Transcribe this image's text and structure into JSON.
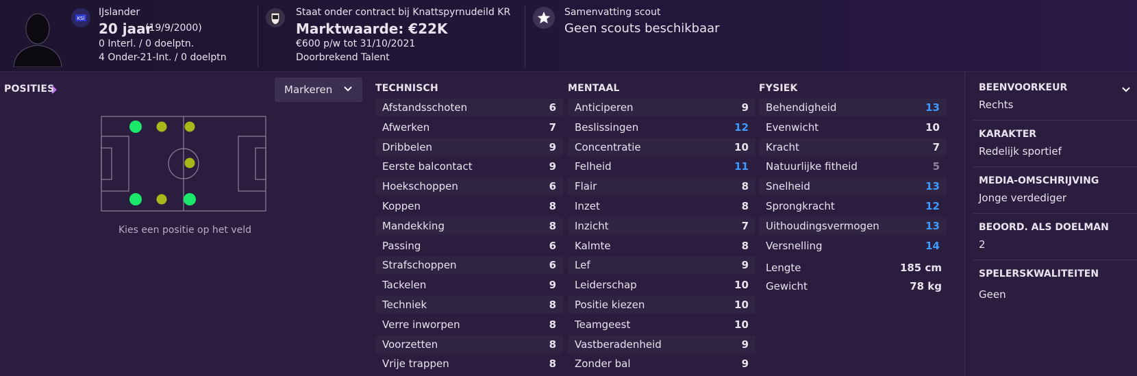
{
  "header": {
    "nationality": "IJslander",
    "age": "20 jaar",
    "birthdate": "(19/9/2000)",
    "caps": "0 Interl. / 0 doelptn.",
    "u21_caps": "4 Onder-21-Int. / 0 doelptn",
    "contract": "Staat onder contract bij Knattspyrnudeild KR",
    "market_value": "Marktwaarde: €22K",
    "wage": "€600 p/w tot 31/10/2021",
    "status": "Doorbrekend Talent",
    "scout_title": "Samenvatting scout",
    "scout_value": "Geen scouts beschikbaar"
  },
  "positions": {
    "label": "POSITIES",
    "mark_button": "Markeren",
    "hint": "Kies een positie op het veld"
  },
  "technical": {
    "title": "TECHNISCH",
    "items": [
      {
        "name": "Afstandsschoten",
        "value": "6"
      },
      {
        "name": "Afwerken",
        "value": "7"
      },
      {
        "name": "Dribbelen",
        "value": "9"
      },
      {
        "name": "Eerste balcontact",
        "value": "9"
      },
      {
        "name": "Hoekschoppen",
        "value": "6"
      },
      {
        "name": "Koppen",
        "value": "8"
      },
      {
        "name": "Mandekking",
        "value": "8"
      },
      {
        "name": "Passing",
        "value": "6"
      },
      {
        "name": "Strafschoppen",
        "value": "6"
      },
      {
        "name": "Tackelen",
        "value": "9"
      },
      {
        "name": "Techniek",
        "value": "8"
      },
      {
        "name": "Verre inworpen",
        "value": "8"
      },
      {
        "name": "Voorzetten",
        "value": "8"
      },
      {
        "name": "Vrije trappen",
        "value": "8"
      }
    ]
  },
  "mental": {
    "title": "MENTAAL",
    "items": [
      {
        "name": "Anticiperen",
        "value": "9"
      },
      {
        "name": "Beslissingen",
        "value": "12"
      },
      {
        "name": "Concentratie",
        "value": "10"
      },
      {
        "name": "Felheid",
        "value": "11"
      },
      {
        "name": "Flair",
        "value": "8"
      },
      {
        "name": "Inzet",
        "value": "8"
      },
      {
        "name": "Inzicht",
        "value": "7"
      },
      {
        "name": "Kalmte",
        "value": "8"
      },
      {
        "name": "Lef",
        "value": "9"
      },
      {
        "name": "Leiderschap",
        "value": "10"
      },
      {
        "name": "Positie kiezen",
        "value": "10"
      },
      {
        "name": "Teamgeest",
        "value": "10"
      },
      {
        "name": "Vastberadenheid",
        "value": "9"
      },
      {
        "name": "Zonder bal",
        "value": "9"
      }
    ]
  },
  "physical": {
    "title": "FYSIEK",
    "items": [
      {
        "name": "Behendigheid",
        "value": "13"
      },
      {
        "name": "Evenwicht",
        "value": "10"
      },
      {
        "name": "Kracht",
        "value": "7"
      },
      {
        "name": "Natuurlijke fitheid",
        "value": "5"
      },
      {
        "name": "Snelheid",
        "value": "13"
      },
      {
        "name": "Sprongkracht",
        "value": "12"
      },
      {
        "name": "Uithoudingsvermogen",
        "value": "13"
      },
      {
        "name": "Versnelling",
        "value": "14"
      }
    ],
    "height_label": "Lengte",
    "height_value": "185 cm",
    "weight_label": "Gewicht",
    "weight_value": "78 kg"
  },
  "profile": {
    "foot_title": "BEENVOORKEUR",
    "foot_value": "Rechts",
    "character_title": "KARAKTER",
    "character_value": "Redelijk sportief",
    "media_title": "MEDIA-OMSCHRIJVING",
    "media_value": "Jonge verdediger",
    "gk_title": "BEOORD. ALS DOELMAN",
    "gk_value": "2",
    "qualities_title": "SPELERSKWALITEITEN",
    "qualities_value": "Geen"
  },
  "colors": {
    "blue_value": "#3d9bff",
    "grey_value": "#8c8498",
    "natural_position": "#19e86a",
    "accomplished_position": "#a8b81a"
  }
}
